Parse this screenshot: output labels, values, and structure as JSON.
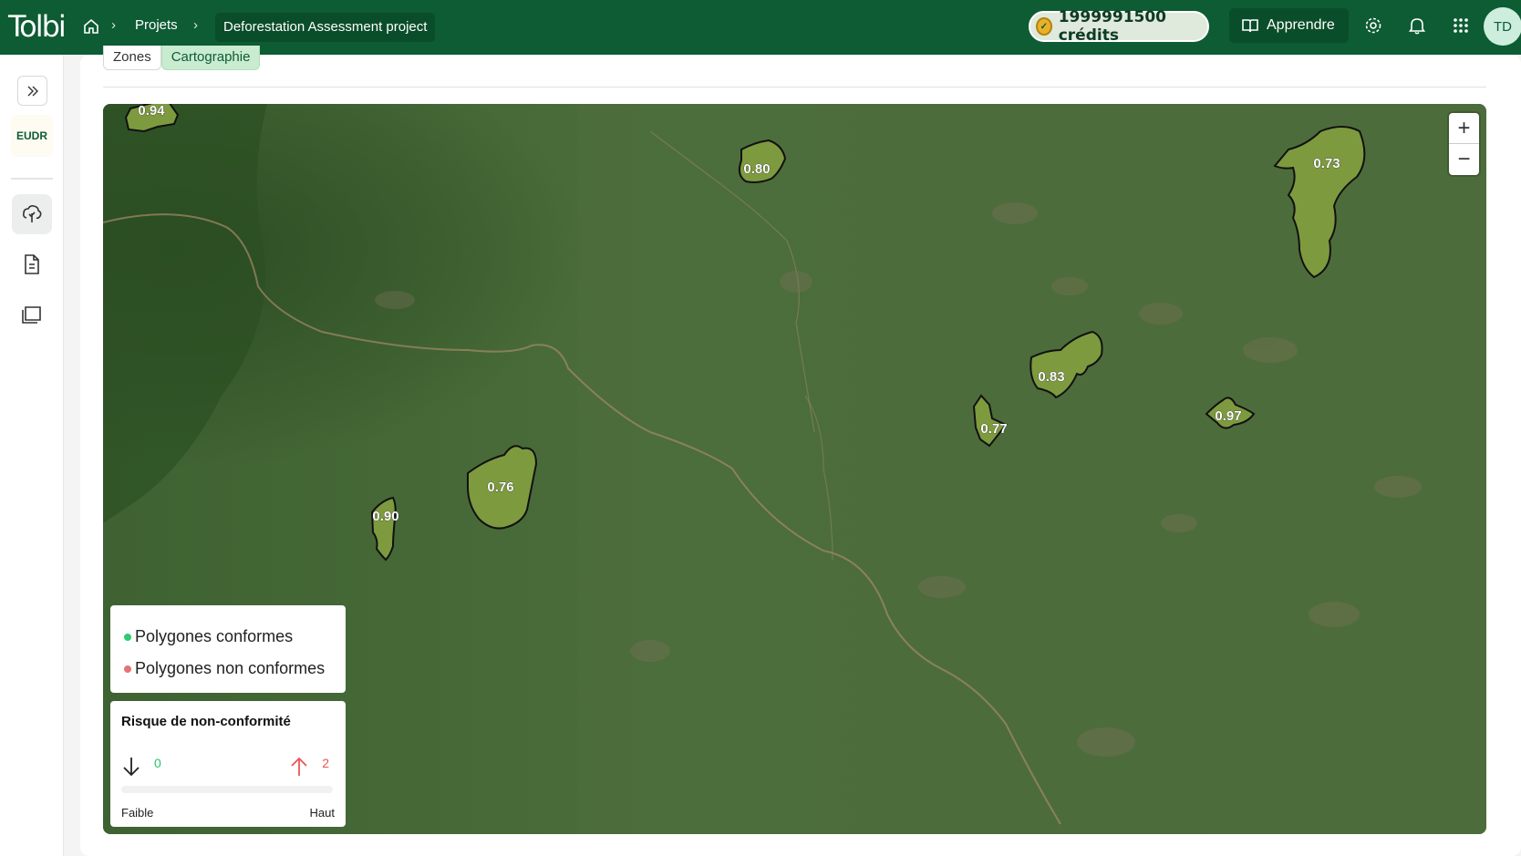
{
  "app": {
    "logo": "Tolbi"
  },
  "breadcrumb": {
    "projects": "Projets",
    "current": "Deforestation Assessment project"
  },
  "header": {
    "credits": "1999991500 crédits",
    "learn": "Apprendre",
    "avatar": "TD"
  },
  "sidebar": {
    "module": "EUDR"
  },
  "tabs": [
    {
      "label": "Zones"
    },
    {
      "label": "Cartographie"
    }
  ],
  "map": {
    "zoom_in": "+",
    "zoom_out": "−",
    "polygons": [
      {
        "score": "0.94"
      },
      {
        "score": "0.80"
      },
      {
        "score": "0.73"
      },
      {
        "score": "0.83"
      },
      {
        "score": "0.77"
      },
      {
        "score": "0.97"
      },
      {
        "score": "0.76"
      },
      {
        "score": "0.90"
      }
    ],
    "polygon_fill": "#7d9a3e"
  },
  "legend": {
    "compliant": {
      "label": "Polygones conformes",
      "color": "#2ecc71"
    },
    "non_compliant": {
      "label": "Polygones non conformes",
      "color": "#e57373"
    }
  },
  "risk": {
    "title": "Risque de non-conformité",
    "min_value": "0",
    "max_value": "2",
    "low_label": "Faible",
    "high_label": "Haut"
  },
  "colors": {
    "brand": "#0d5c34",
    "accent": "#c9ebcf"
  }
}
